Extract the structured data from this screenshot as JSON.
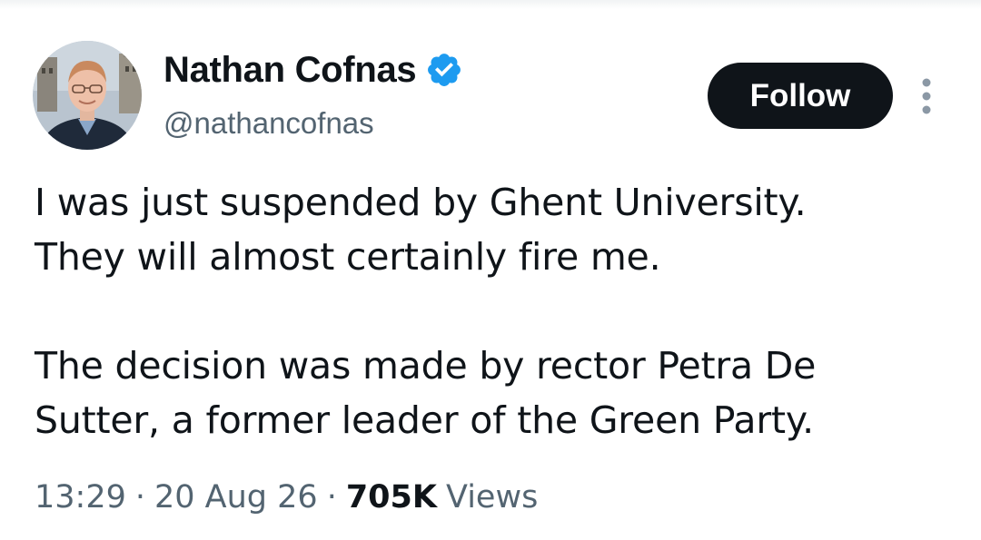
{
  "author": {
    "display_name": "Nathan Cofnas",
    "handle": "@nathancofnas",
    "verified_icon": "verified-badge-icon",
    "verified_color": "#1d9bf0"
  },
  "actions": {
    "follow_label": "Follow",
    "more_icon": "more-vertical-icon"
  },
  "tweet": {
    "paragraphs": [
      "I was just suspended by Ghent University.\nThey will almost certainly fire me.",
      "The decision was made by rector Petra De\nSutter, a former leader of the Green Party."
    ]
  },
  "meta": {
    "time": "13:29",
    "separator": "·",
    "date": "20 Aug 26",
    "views_count": "705K",
    "views_label": "Views"
  },
  "colors": {
    "text_primary": "#0f1419",
    "text_secondary": "#536471",
    "button_bg": "#0f1419",
    "button_text": "#ffffff"
  }
}
